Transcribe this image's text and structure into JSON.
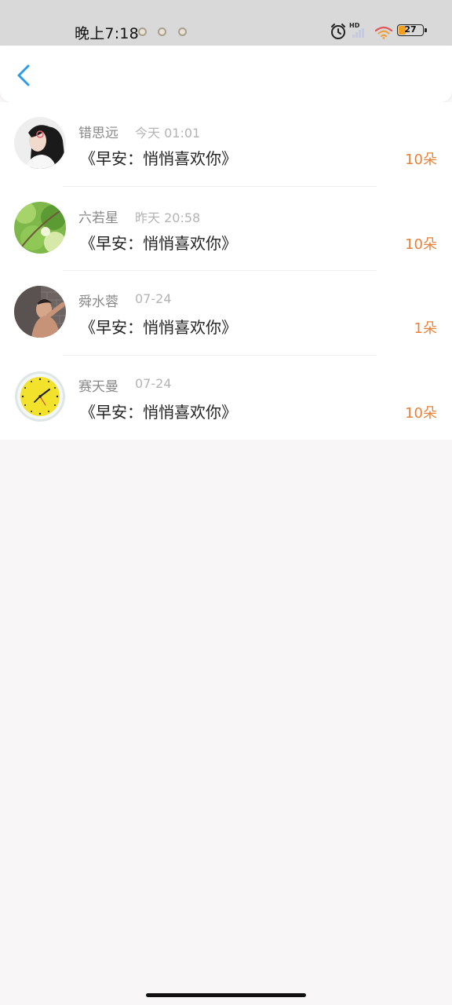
{
  "status_bar": {
    "time": "晚上7:18",
    "battery_level": "27",
    "icons": [
      "notification-dot-icon",
      "alarm-icon",
      "hd-signal-icon",
      "wifi-icon",
      "battery-icon"
    ]
  },
  "nav": {
    "back_icon": "chevron-left-icon",
    "accent_color": "#2e9be8"
  },
  "items": [
    {
      "name": "错思远",
      "time": "今天 01:01",
      "title": "《早安：悄悄喜欢你》",
      "count": "10朵",
      "avatar": "girl-photo"
    },
    {
      "name": "六若星",
      "time": "昨天 20:58",
      "title": "《早安：悄悄喜欢你》",
      "count": "10朵",
      "avatar": "green-leaves-photo"
    },
    {
      "name": "舜水蓉",
      "time": "07-24",
      "title": "《早安：悄悄喜欢你》",
      "count": "1朵",
      "avatar": "person-wall-photo"
    },
    {
      "name": "赛天曼",
      "time": "07-24",
      "title": "《早安：悄悄喜欢你》",
      "count": "10朵",
      "avatar": "yellow-clock-image"
    }
  ],
  "colors": {
    "count_text": "#e8823a",
    "name_text": "#888888",
    "time_text": "#b4b4b4",
    "title_text": "#222222",
    "page_bg": "#f8f6f7"
  }
}
